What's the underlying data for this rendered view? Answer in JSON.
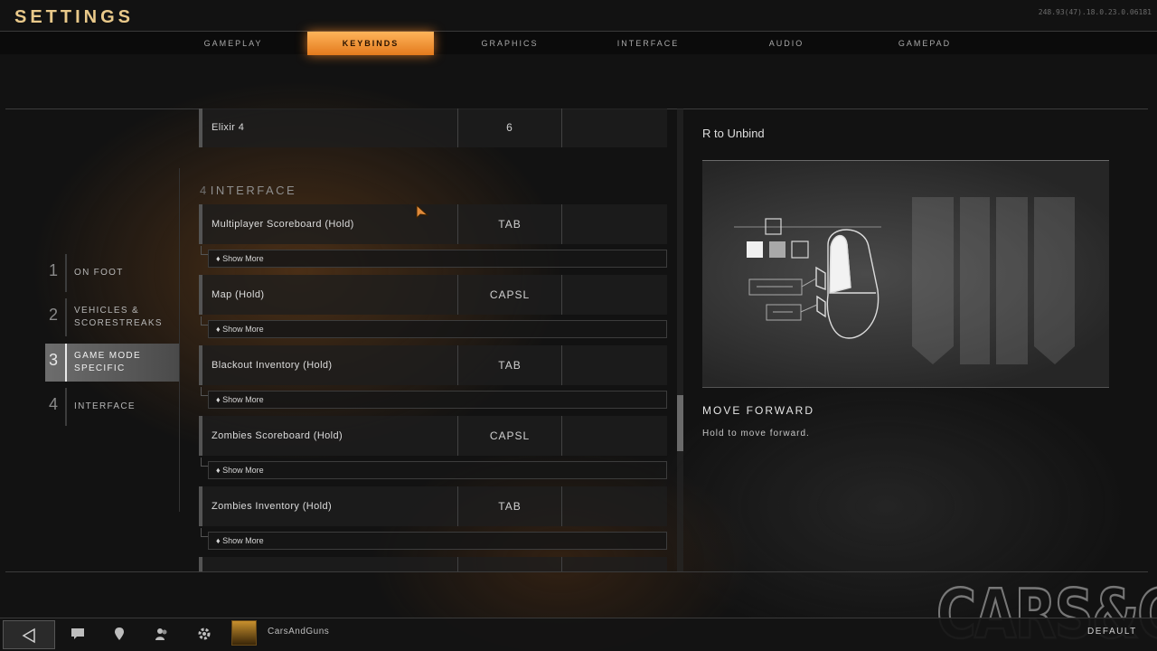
{
  "header": {
    "title": "SETTINGS",
    "version": "248.93(47).18.0.23.0.06181"
  },
  "tabs": [
    {
      "label": "GAMEPLAY",
      "active": false
    },
    {
      "label": "KEYBINDS",
      "active": true
    },
    {
      "label": "GRAPHICS",
      "active": false
    },
    {
      "label": "INTERFACE",
      "active": false
    },
    {
      "label": "AUDIO",
      "active": false
    },
    {
      "label": "GAMEPAD",
      "active": false
    }
  ],
  "sidebar": {
    "items": [
      {
        "num": "1",
        "label": "ON FOOT"
      },
      {
        "num": "2",
        "label": "VEHICLES & SCORESTREAKS"
      },
      {
        "num": "3",
        "label": "GAME MODE SPECIFIC",
        "active": true
      },
      {
        "num": "4",
        "label": "INTERFACE"
      }
    ]
  },
  "bindings": {
    "prev_row": {
      "action": "Elixir 4",
      "key1": "6",
      "key2": ""
    },
    "section": {
      "num": "4",
      "title": "INTERFACE"
    },
    "rows": [
      {
        "action": "Multiplayer Scoreboard (Hold)",
        "key1": "TAB",
        "key2": "",
        "show_more": "Show More"
      },
      {
        "action": "Map (Hold)",
        "key1": "CAPSL",
        "key2": "",
        "show_more": "Show More"
      },
      {
        "action": "Blackout Inventory (Hold)",
        "key1": "TAB",
        "key2": "",
        "show_more": "Show More"
      },
      {
        "action": "Zombies Scoreboard (Hold)",
        "key1": "CAPSL",
        "key2": "",
        "show_more": "Show More"
      },
      {
        "action": "Zombies Inventory (Hold)",
        "key1": "TAB",
        "key2": "",
        "show_more": "Show More"
      }
    ]
  },
  "detail": {
    "unbind_hint": "R to Unbind",
    "action_title": "MOVE FORWARD",
    "action_desc": "Hold to move forward."
  },
  "bottom_bar": {
    "back_icon": "triangle-left-icon",
    "icons": [
      "chat-icon",
      "location-pin-icon",
      "party-icon",
      "gear-icon"
    ],
    "username": "CarsAndGuns",
    "default_label": "DEFAULT"
  },
  "watermark": "CARS&GUNS",
  "colors": {
    "accent": "#f0902e",
    "title": "#e9c98a"
  }
}
